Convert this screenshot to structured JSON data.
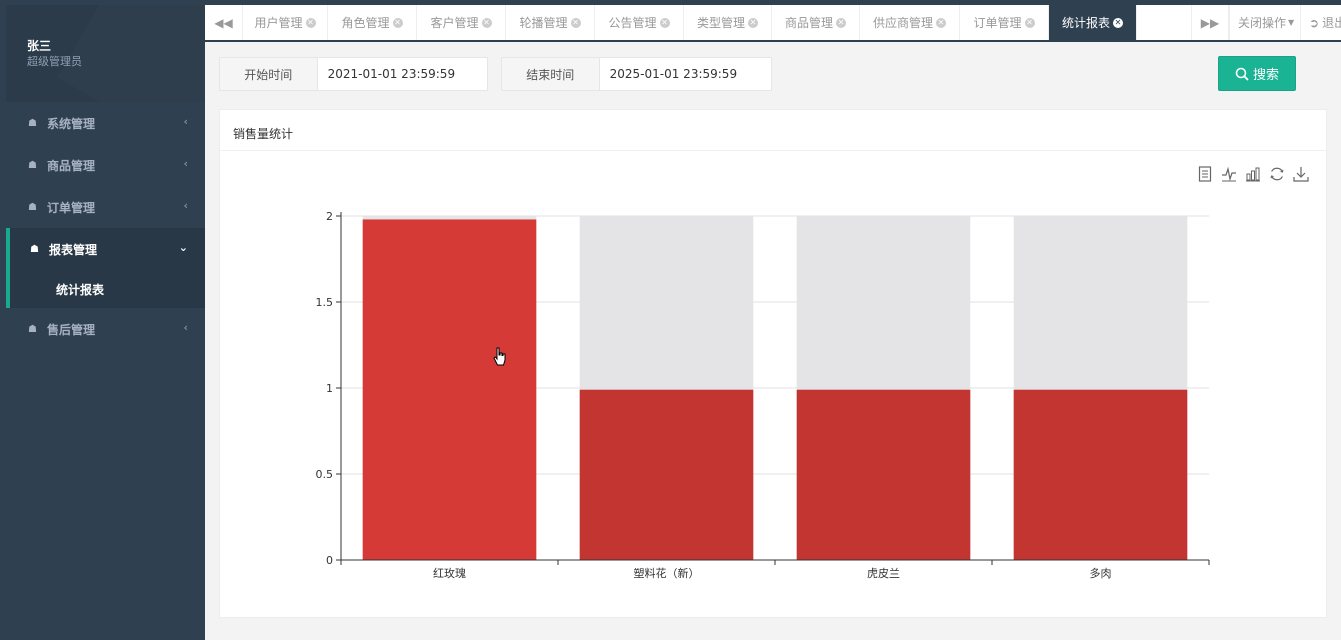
{
  "sidebar": {
    "user_name": "张三",
    "user_role": "超级管理员",
    "menu": [
      {
        "label": "系统管理",
        "icon": "home-icon"
      },
      {
        "label": "商品管理",
        "icon": "home-icon"
      },
      {
        "label": "订单管理",
        "icon": "home-icon"
      },
      {
        "label": "报表管理",
        "icon": "home-icon",
        "expanded": true,
        "children": [
          {
            "label": "统计报表"
          }
        ]
      },
      {
        "label": "售后管理",
        "icon": "home-icon"
      }
    ]
  },
  "tabs": {
    "items": [
      {
        "label": "用户管理"
      },
      {
        "label": "角色管理"
      },
      {
        "label": "客户管理"
      },
      {
        "label": "轮播管理"
      },
      {
        "label": "公告管理"
      },
      {
        "label": "类型管理"
      },
      {
        "label": "商品管理"
      },
      {
        "label": "供应商管理"
      },
      {
        "label": "订单管理"
      },
      {
        "label": "统计报表",
        "active": true
      }
    ],
    "close_menu_label": "关闭操作",
    "logout_label": "退出"
  },
  "filters": {
    "start_label": "开始时间",
    "start_value": "2021-01-01 23:59:59",
    "end_label": "结束时间",
    "end_value": "2025-01-01 23:59:59",
    "search_label": "搜索"
  },
  "panel": {
    "title": "销售量统计",
    "toolbox": [
      "data-view-icon",
      "line-chart-icon",
      "bar-chart-icon",
      "restore-icon",
      "download-icon"
    ]
  },
  "colors": {
    "sidebar_bg": "#2f4050",
    "accent": "#1ab394",
    "bar": "#c23531",
    "bar_hover": "#d63a36",
    "bar_background": "#e4e3e6"
  },
  "chart_data": {
    "type": "bar",
    "categories": [
      "红玫瑰",
      "塑料花（新）",
      "虎皮兰",
      "多肉"
    ],
    "values": [
      2,
      1,
      1,
      1
    ],
    "ylim": [
      0,
      2
    ],
    "yticks": [
      "0",
      "0.5",
      "1",
      "1.5",
      "2"
    ],
    "grid": true
  }
}
